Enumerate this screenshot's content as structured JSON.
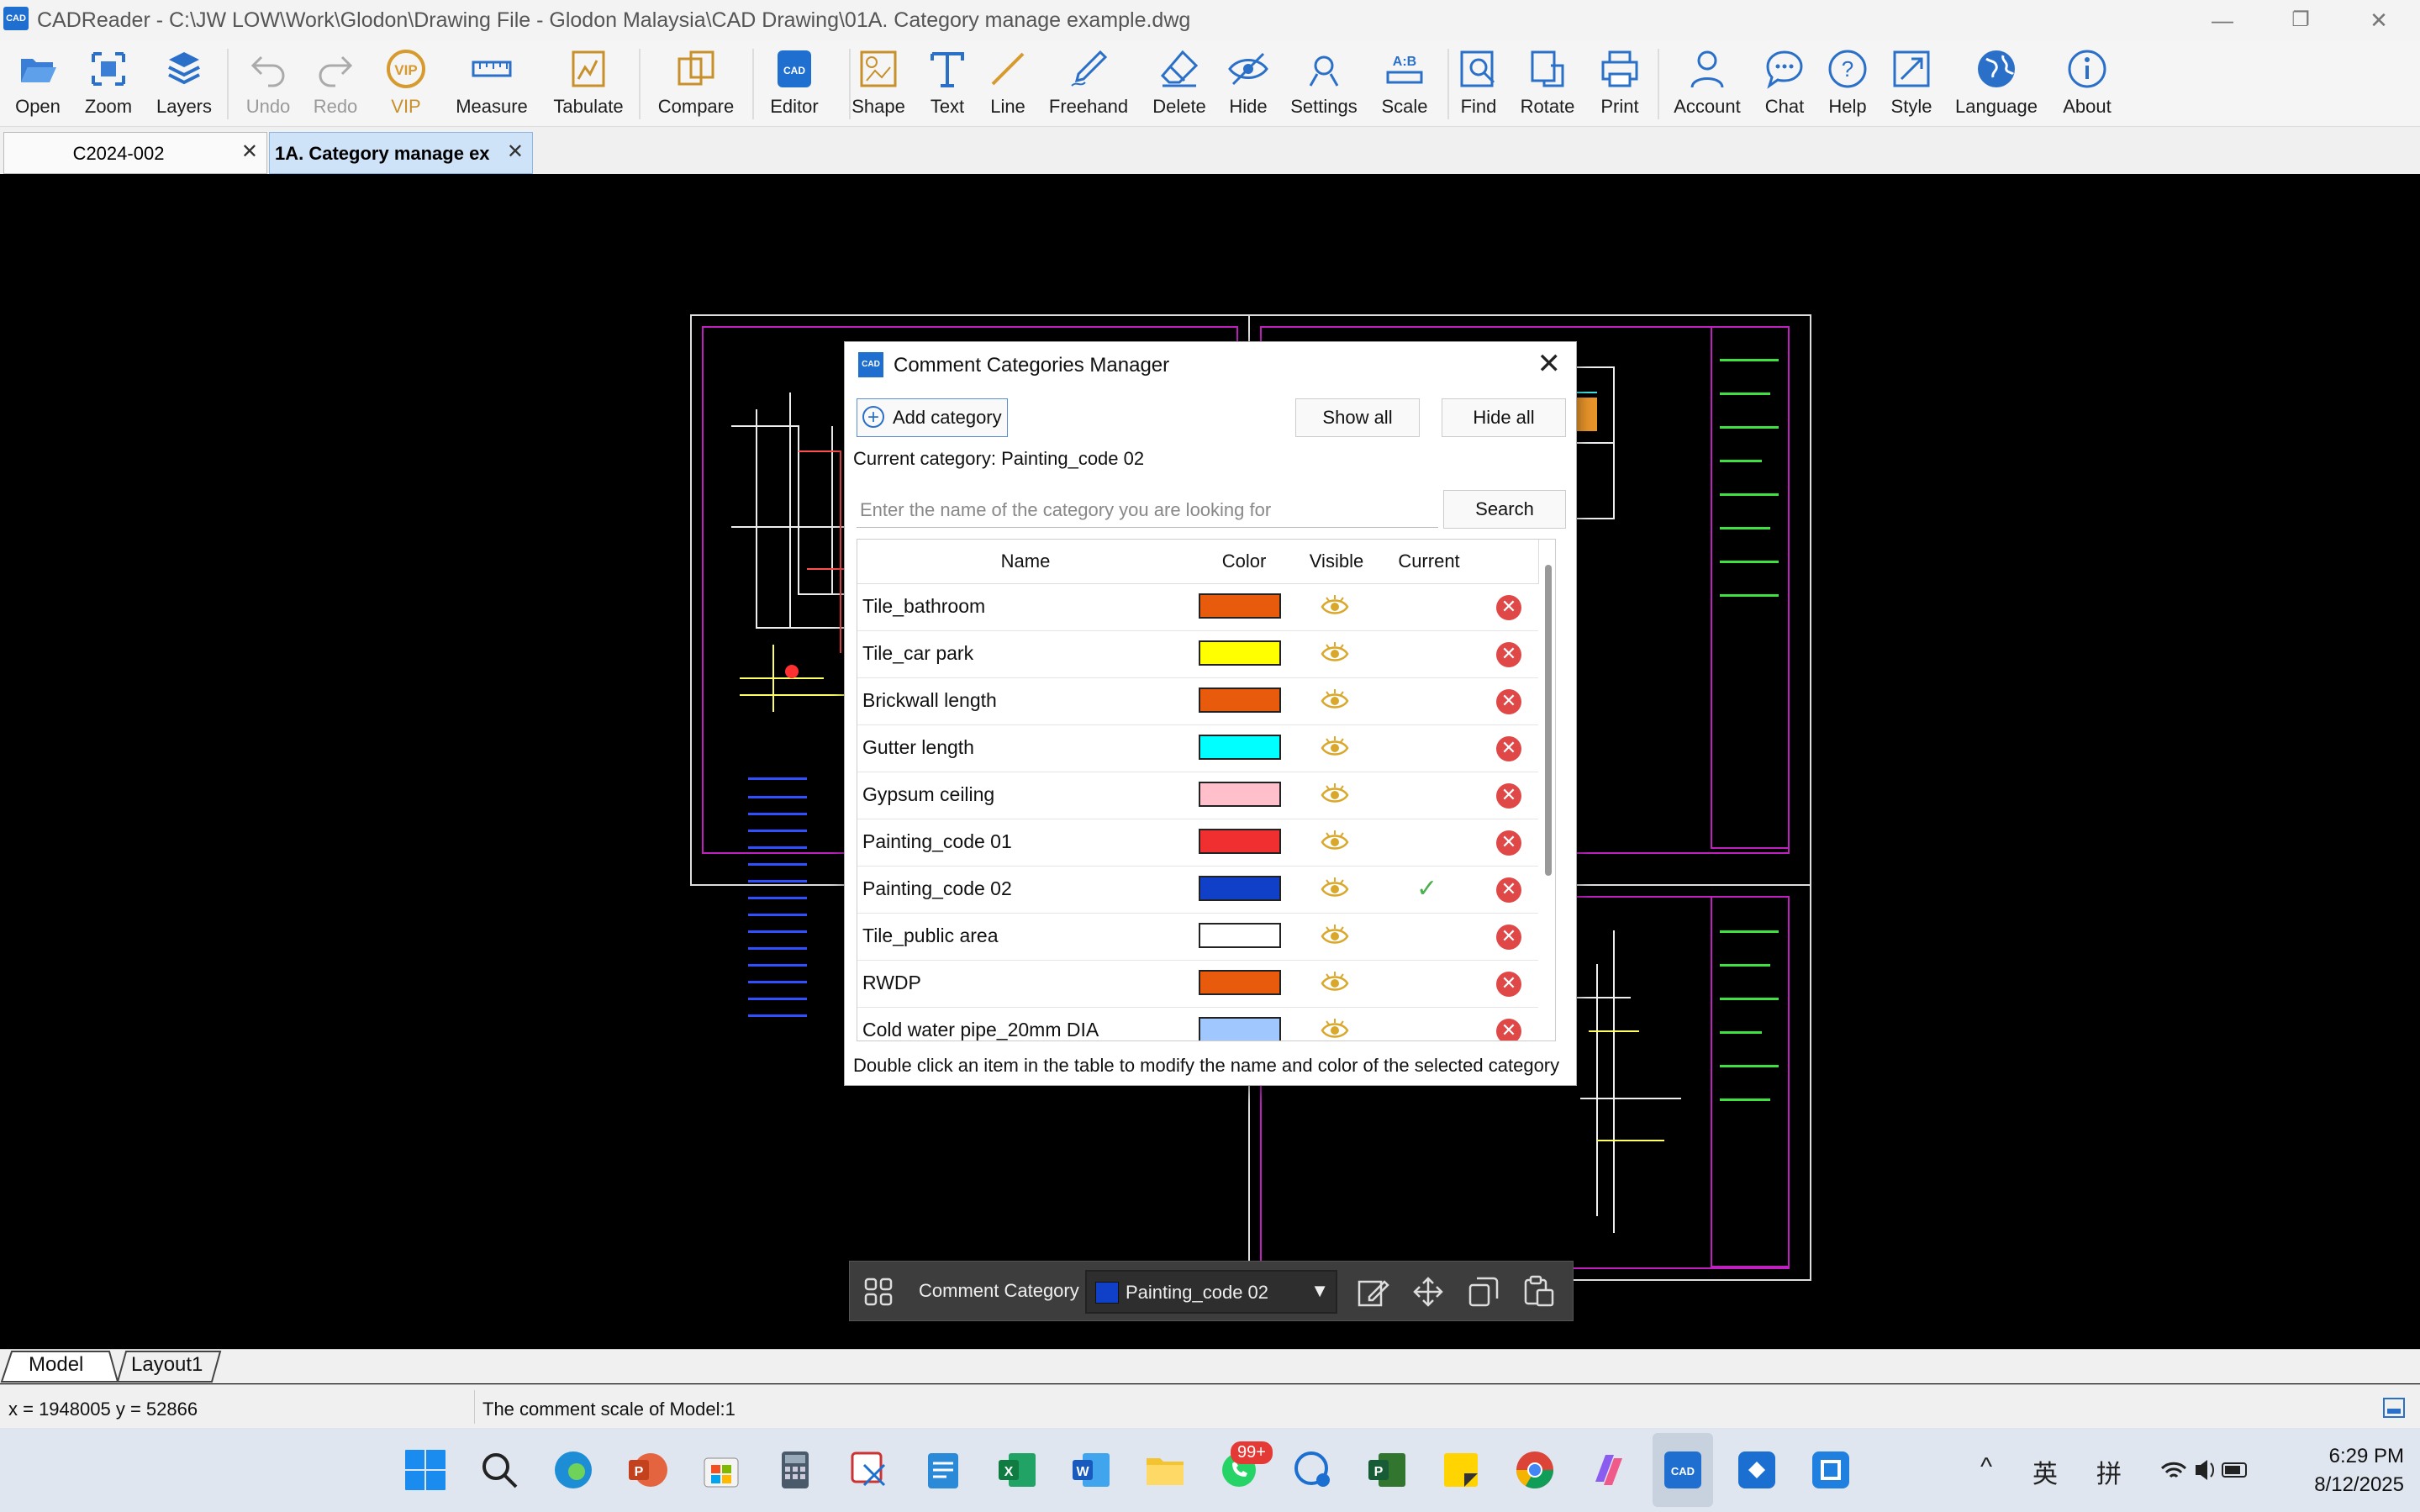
{
  "window": {
    "title": "CADReader - C:\\JW LOW\\Work\\Glodon\\Drawing File - Glodon Malaysia\\CAD Drawing\\01A. Category manage example.dwg",
    "logo": "CAD",
    "min": "—",
    "restore": "❐",
    "close": "✕"
  },
  "toolbar": {
    "open": "Open",
    "zoom": "Zoom",
    "layers": "Layers",
    "undo": "Undo",
    "redo": "Redo",
    "vip": "VIP",
    "measure": "Measure",
    "tabulate": "Tabulate",
    "compare": "Compare",
    "editor": "Editor",
    "shape": "Shape",
    "text": "Text",
    "line": "Line",
    "freehand": "Freehand",
    "delete": "Delete",
    "hide": "Hide",
    "settings": "Settings",
    "scale": "Scale",
    "find": "Find",
    "rotate": "Rotate",
    "print": "Print",
    "account": "Account",
    "chat": "Chat",
    "help": "Help",
    "style": "Style",
    "language": "Language",
    "about": "About"
  },
  "tabs": [
    {
      "label": "C2024-002",
      "close": "✕"
    },
    {
      "label": "1A. Category manage ex",
      "close": "✕"
    }
  ],
  "dialog": {
    "icon": "CAD",
    "title": "Comment Categories Manager",
    "close": "✕",
    "add_category": "Add category",
    "add_icon": "+",
    "show_all": "Show all",
    "hide_all": "Hide all",
    "current_category": "Current category: Painting_code 02",
    "search_placeholder": "Enter the name of the category you are looking for",
    "search_button": "Search",
    "columns": {
      "name": "Name",
      "color": "Color",
      "visible": "Visible",
      "current": "Current"
    },
    "rows": [
      {
        "name": "Tile_bathroom",
        "color": "#e85a0c",
        "current": false
      },
      {
        "name": "Tile_car park",
        "color": "#ffff00",
        "current": false
      },
      {
        "name": "Brickwall length",
        "color": "#e85a0c",
        "current": false
      },
      {
        "name": "Gutter length",
        "color": "#00ffff",
        "current": false
      },
      {
        "name": "Gypsum ceiling",
        "color": "#ffc0cb",
        "current": false
      },
      {
        "name": "Painting_code 01",
        "color": "#f03030",
        "current": false
      },
      {
        "name": "Painting_code 02",
        "color": "#1040c8",
        "current": true
      },
      {
        "name": "Tile_public area",
        "color": "#ffffff",
        "current": false
      },
      {
        "name": "RWDP",
        "color": "#e85a0c",
        "current": false
      },
      {
        "name": "Cold water pipe_20mm DIA",
        "color": "#a0c8ff",
        "current": false
      }
    ],
    "check": "✓",
    "delete_icon": "✕",
    "footer": "Double click an item in the table to modify the name and color of the selected category"
  },
  "comment_bar": {
    "label": "Comment Category",
    "selected": "Painting_code 02",
    "selected_color": "#1040c8",
    "arrow": "▼"
  },
  "layout_tabs": {
    "model": "Model",
    "layout1": "Layout1"
  },
  "status": {
    "coords": "x = 1948005  y = 52866",
    "scale": "The comment scale of Model:1"
  },
  "taskbar": {
    "badge": "99+",
    "lang1": "英",
    "lang2": "拼",
    "caret": "^",
    "time": "6:29 PM",
    "date": "8/12/2025"
  }
}
